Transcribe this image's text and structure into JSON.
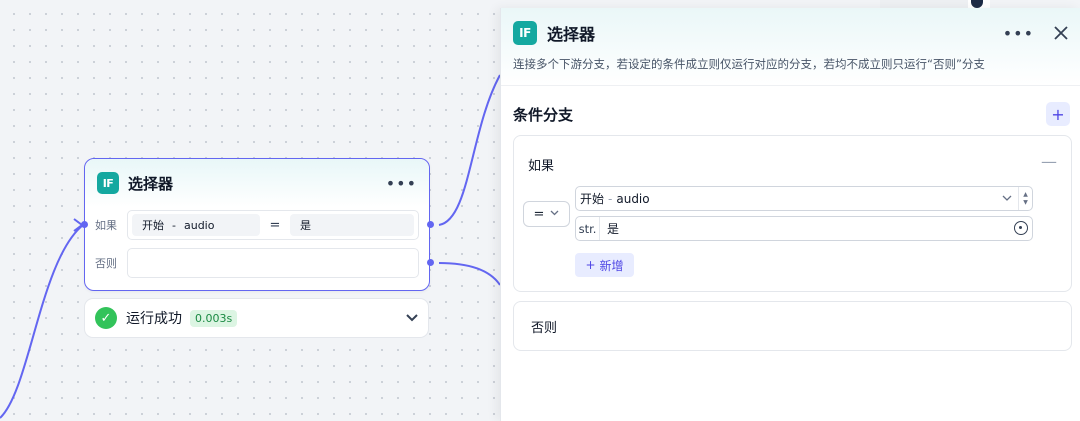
{
  "node": {
    "title": "选择器",
    "if_label": "如果",
    "else_label": "否则",
    "condition": {
      "variable_source": "开始",
      "variable_separator": "-",
      "variable_name": "audio",
      "operator": "=",
      "value": "是"
    },
    "more_icon": "more-dots-icon"
  },
  "run_status": {
    "text": "运行成功",
    "duration": "0.003s"
  },
  "panel": {
    "icon_text": "IF",
    "title": "选择器",
    "description": "连接多个下游分支，若设定的条件成立则仅运行对应的分支，若均不成立则只运行“否则”分支",
    "section_title": "条件分支",
    "if_label": "如果",
    "operator": "=",
    "variable_source": "开始",
    "variable_separator": "-",
    "variable_name": "audio",
    "value_type": "str.",
    "value": "是",
    "add_condition_label": "新增",
    "else_label": "否则"
  },
  "colors": {
    "accent": "#6366f1",
    "if_icon_bg": "#14a8a0",
    "success": "#32c35a"
  }
}
